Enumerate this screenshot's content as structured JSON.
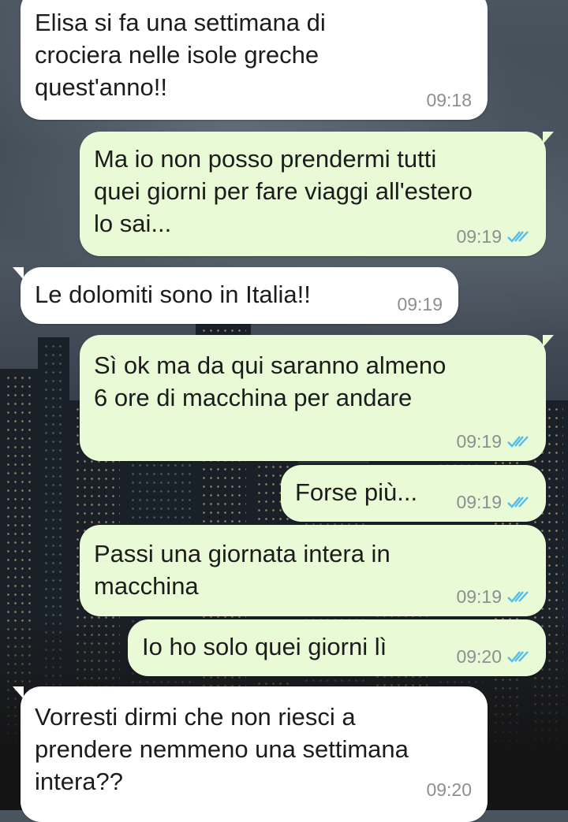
{
  "colors": {
    "incoming_bubble": "#ffffff",
    "outgoing_bubble": "#e8fbd6",
    "read_ticks": "#53bdeb",
    "timestamp": "#8c8f92"
  },
  "icons": {
    "read_receipt": "double-check-icon"
  },
  "messages": [
    {
      "direction": "in",
      "text": "Elisa si fa una settimana di\ncrociera nelle isole greche\nquest'anno!!",
      "time": "09:18"
    },
    {
      "direction": "out",
      "text": "Ma io non posso prendermi tutti\nquei giorni per fare viaggi all'estero\nlo sai...",
      "time": "09:19",
      "status": "read"
    },
    {
      "direction": "in",
      "text": "Le dolomiti sono in Italia!!",
      "time": "09:19"
    },
    {
      "direction": "out",
      "text": "Sì ok ma da qui saranno almeno\n6 ore di macchina per andare",
      "time": "09:19",
      "status": "read"
    },
    {
      "direction": "out",
      "text": "Forse più...",
      "time": "09:19",
      "status": "read"
    },
    {
      "direction": "out",
      "text": "Passi una giornata intera in\nmacchina",
      "time": "09:19",
      "status": "read"
    },
    {
      "direction": "out",
      "text": "Io ho solo quei giorni lì",
      "time": "09:20",
      "status": "read"
    },
    {
      "direction": "in",
      "text": "Vorresti dirmi che non riesci a\nprendere nemmeno una settimana\nintera??",
      "time": "09:20"
    }
  ]
}
